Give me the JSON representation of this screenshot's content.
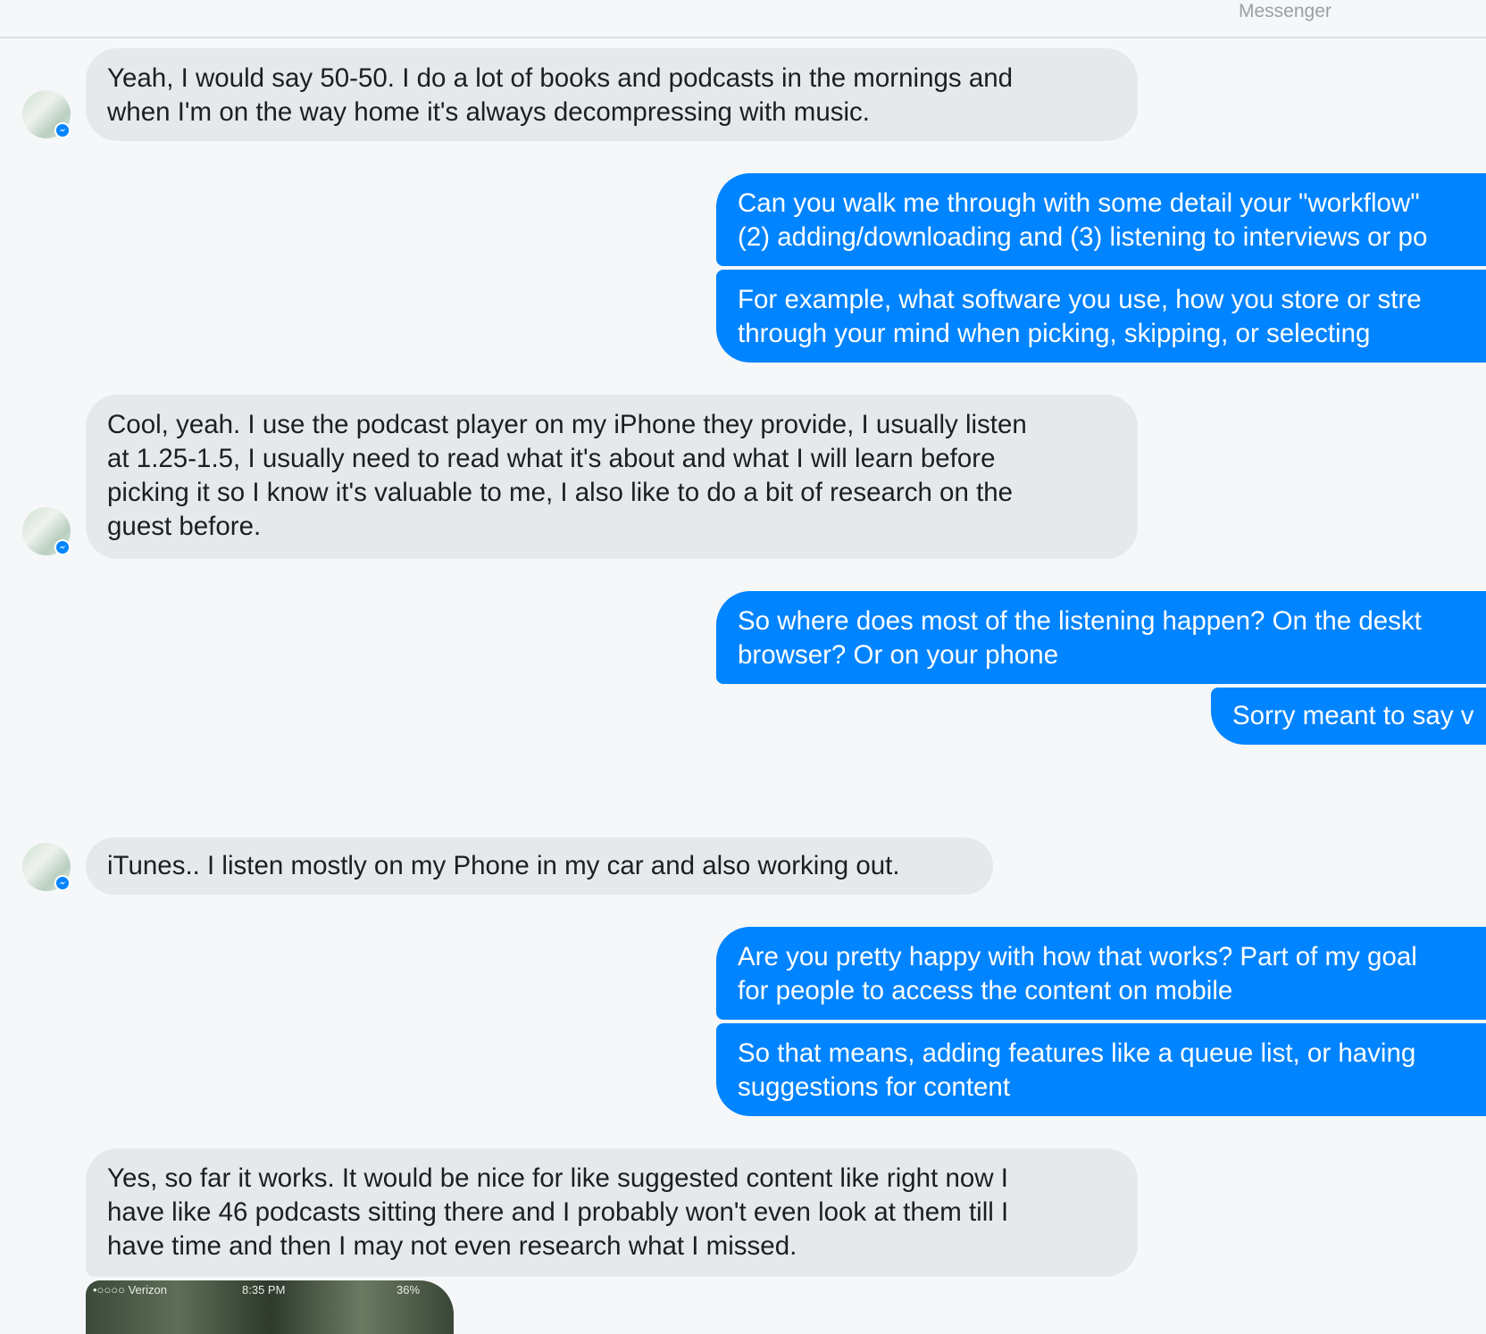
{
  "header": {
    "title": "Messenger"
  },
  "messages": [
    {
      "from": "them",
      "lines": [
        "Yeah, I would say 50-50. I do a lot of books and podcasts in the mornings and",
        "when I'm on the way home it's always decompressing with music."
      ]
    },
    {
      "from": "me",
      "lines": [
        "Can you walk me through with some detail your \"workflow\"",
        "(2) adding/downloading and (3) listening to interviews or po"
      ]
    },
    {
      "from": "me",
      "lines": [
        "For example, what software you use, how you store or stre",
        "through your mind when picking, skipping, or selecting"
      ]
    },
    {
      "from": "them",
      "lines": [
        "Cool, yeah. I use the podcast player on my iPhone they provide, I usually listen",
        "at 1.25-1.5, I usually need to read what it's about and what I will learn before",
        "picking it so I know it's valuable to me, I also like to do a bit of research on the",
        "guest before."
      ]
    },
    {
      "from": "me",
      "lines": [
        "So where does most of the listening happen? On the deskt",
        "browser? Or on your phone"
      ]
    },
    {
      "from": "me",
      "lines": [
        "Sorry meant to say v"
      ]
    },
    {
      "from": "them",
      "lines": [
        "iTunes.. I listen mostly on my Phone in my car and also working out."
      ]
    },
    {
      "from": "me",
      "lines": [
        "Are you pretty happy with how that works? Part of my goal",
        "for people to access the content on mobile"
      ]
    },
    {
      "from": "me",
      "lines": [
        "So that means, adding features like a queue list, or having",
        "suggestions for content"
      ]
    },
    {
      "from": "them",
      "lines": [
        "Yes, so far it works. It would be nice for like suggested content like right now I",
        "have like 46 podcasts sitting there and I probably won't even look at them till I",
        "have time and then I may not even research what I missed."
      ]
    }
  ],
  "attachment": {
    "status_carrier": "•○○○○ Verizon",
    "status_time": "8:35 PM",
    "status_battery": "36%"
  },
  "colors": {
    "outgoing_bubble": "#0084ff",
    "incoming_bubble": "#e6e9ec",
    "background": "#f5f7f9"
  }
}
